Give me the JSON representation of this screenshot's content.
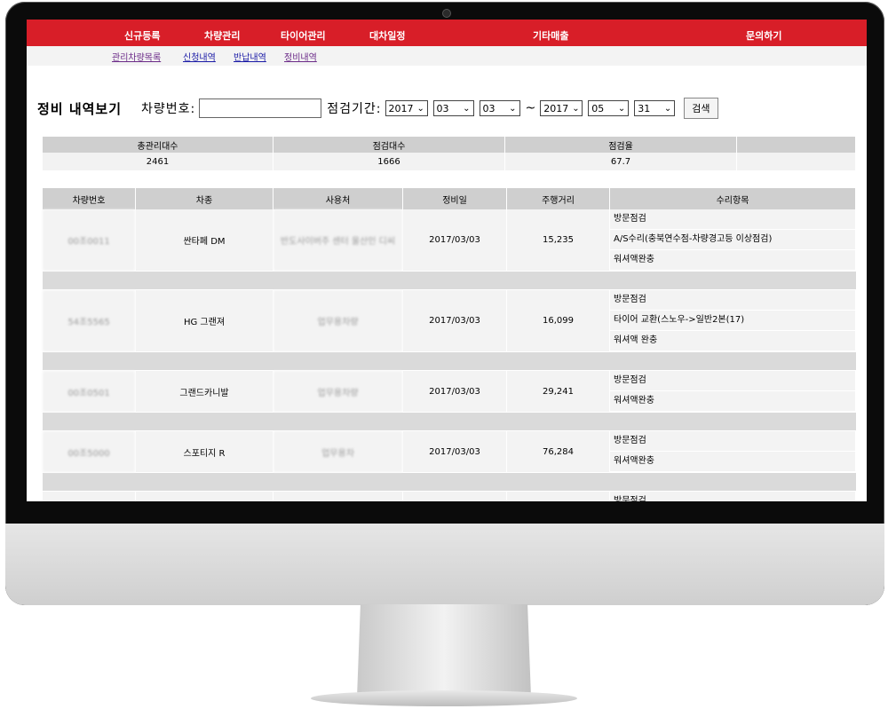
{
  "topnav": [
    "신규등록",
    "차량관리",
    "타이어관리",
    "대차일정",
    "기타매출",
    "문의하기"
  ],
  "subnav": [
    "관리차량목록",
    "신청내역",
    "반납내역",
    "정비내역"
  ],
  "page": {
    "title": "정비 내역보기",
    "car_no_label": "차량번호:",
    "car_no_value": "",
    "period_label": "점검기간:",
    "from_year": "2017",
    "from_month": "03",
    "from_day": "03",
    "tilde": "~",
    "to_year": "2017",
    "to_month": "05",
    "to_day": "31",
    "search_button": "검색"
  },
  "summary": {
    "headers": [
      "총관리대수",
      "점검대수",
      "점검율"
    ],
    "values": [
      "2461",
      "1666",
      "67.7"
    ]
  },
  "detail": {
    "headers": [
      "차량번호",
      "차종",
      "사용처",
      "정비일",
      "주행거리",
      "수리항목"
    ],
    "rows": [
      {
        "car_no": "00조0011",
        "model": "싼타페 DM",
        "user": "반도사이버주 센터 울산인 디씨",
        "date": "2017/03/03",
        "km": "15,235",
        "items": [
          "방문점검",
          "A/S수리(충북연수점-차량경고등 이상점검)",
          "워셔액완충"
        ]
      },
      {
        "car_no": "54조5565",
        "model": "HG 그랜져",
        "user": "업무용차량",
        "date": "2017/03/03",
        "km": "16,099",
        "items": [
          "방문점검",
          "타이어 교환(스노우->일반2본(17)",
          "워셔액 완충"
        ]
      },
      {
        "car_no": "00조0501",
        "model": "그랜드카니발",
        "user": "업무용차량",
        "date": "2017/03/03",
        "km": "29,241",
        "items": [
          "방문점검",
          "워셔액완충"
        ]
      },
      {
        "car_no": "00조5000",
        "model": "스포티지 R",
        "user": "업무용차",
        "date": "2017/03/03",
        "km": "76,284",
        "items": [
          "방문점검",
          "워셔액완충"
        ]
      },
      {
        "car_no": "",
        "model": "",
        "user": "",
        "date": "",
        "km": "",
        "items": [
          "방문점검"
        ]
      }
    ]
  }
}
